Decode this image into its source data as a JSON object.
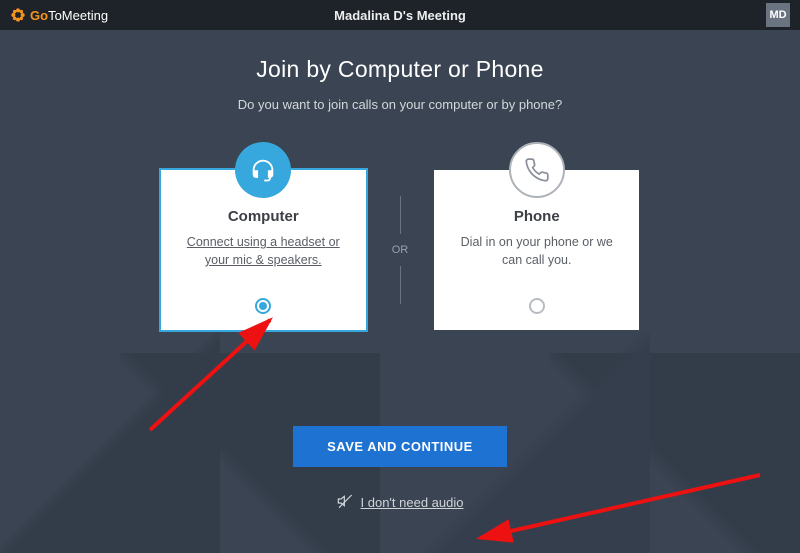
{
  "header": {
    "brand_go": "Go",
    "brand_to": "To",
    "brand_meeting": "Meeting",
    "meeting_title": "Madalina D's Meeting",
    "avatar_initials": "MD"
  },
  "main": {
    "title": "Join by Computer or Phone",
    "subtitle": "Do you want to join calls on your computer or by phone?"
  },
  "cards": {
    "computer": {
      "title": "Computer",
      "description": "Connect using a headset or your mic & speakers.",
      "selected": true
    },
    "divider_label": "OR",
    "phone": {
      "title": "Phone",
      "description": "Dial in on your phone or we can call you.",
      "selected": false
    }
  },
  "actions": {
    "save_label": "SAVE AND CONTINUE",
    "no_audio_label": "I don't need audio"
  },
  "colors": {
    "accent_blue": "#37a8dd",
    "primary_button": "#1d72d2",
    "brand_orange": "#f7941e"
  }
}
